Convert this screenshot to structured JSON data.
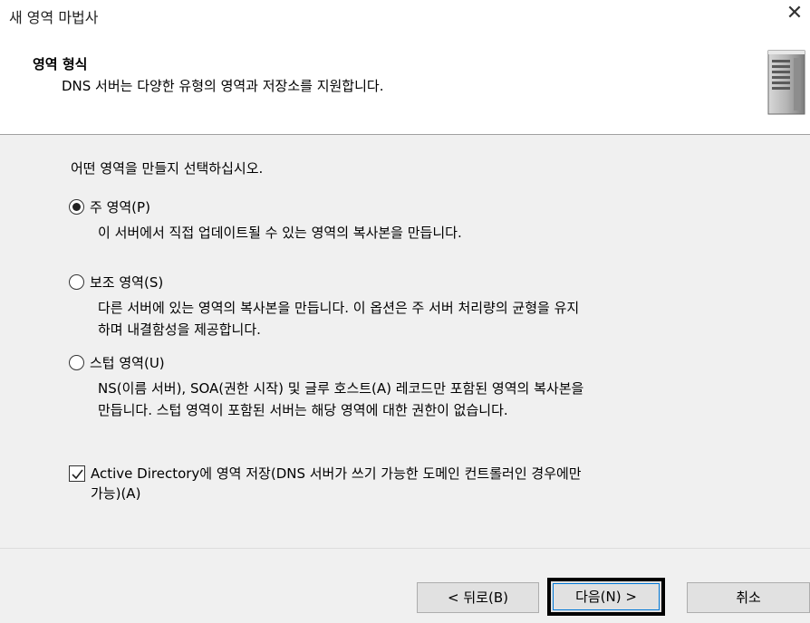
{
  "window": {
    "title": "새 영역 마법사",
    "close_glyph": "✕"
  },
  "header": {
    "title": "영역 형식",
    "subtitle": "DNS 서버는 다양한 유형의 영역과 저장소를 지원합니다."
  },
  "content": {
    "prompt": "어떤 영역을 만들지 선택하십시오.",
    "options": [
      {
        "label": "주 영역(P)",
        "selected": true,
        "description": [
          "이 서버에서 직접 업데이트될 수 있는 영역의 복사본을 만듭니다."
        ]
      },
      {
        "label": "보조 영역(S)",
        "selected": false,
        "description": [
          "다른 서버에 있는 영역의 복사본을 만듭니다. 이 옵션은 주 서버 처리량의 균형을 유지",
          "하며 내결함성을 제공합니다."
        ]
      },
      {
        "label": "스텁 영역(U)",
        "selected": false,
        "description": [
          "NS(이름 서버), SOA(권한 시작) 및 글루 호스트(A) 레코드만 포함된 영역의 복사본을",
          "만듭니다. 스텁 영역이 포함된 서버는 해당 영역에 대한 권한이 없습니다."
        ]
      }
    ],
    "ad_checkbox": {
      "checked": true,
      "label_line1": "Active Directory에 영역 저장(DNS 서버가 쓰기 가능한 도메인 컨트롤러인 경우에만",
      "label_line2": "가능)(A)"
    }
  },
  "footer": {
    "back_label": "< 뒤로(B)",
    "next_label": "다음(N) >",
    "cancel_label": "취소"
  }
}
